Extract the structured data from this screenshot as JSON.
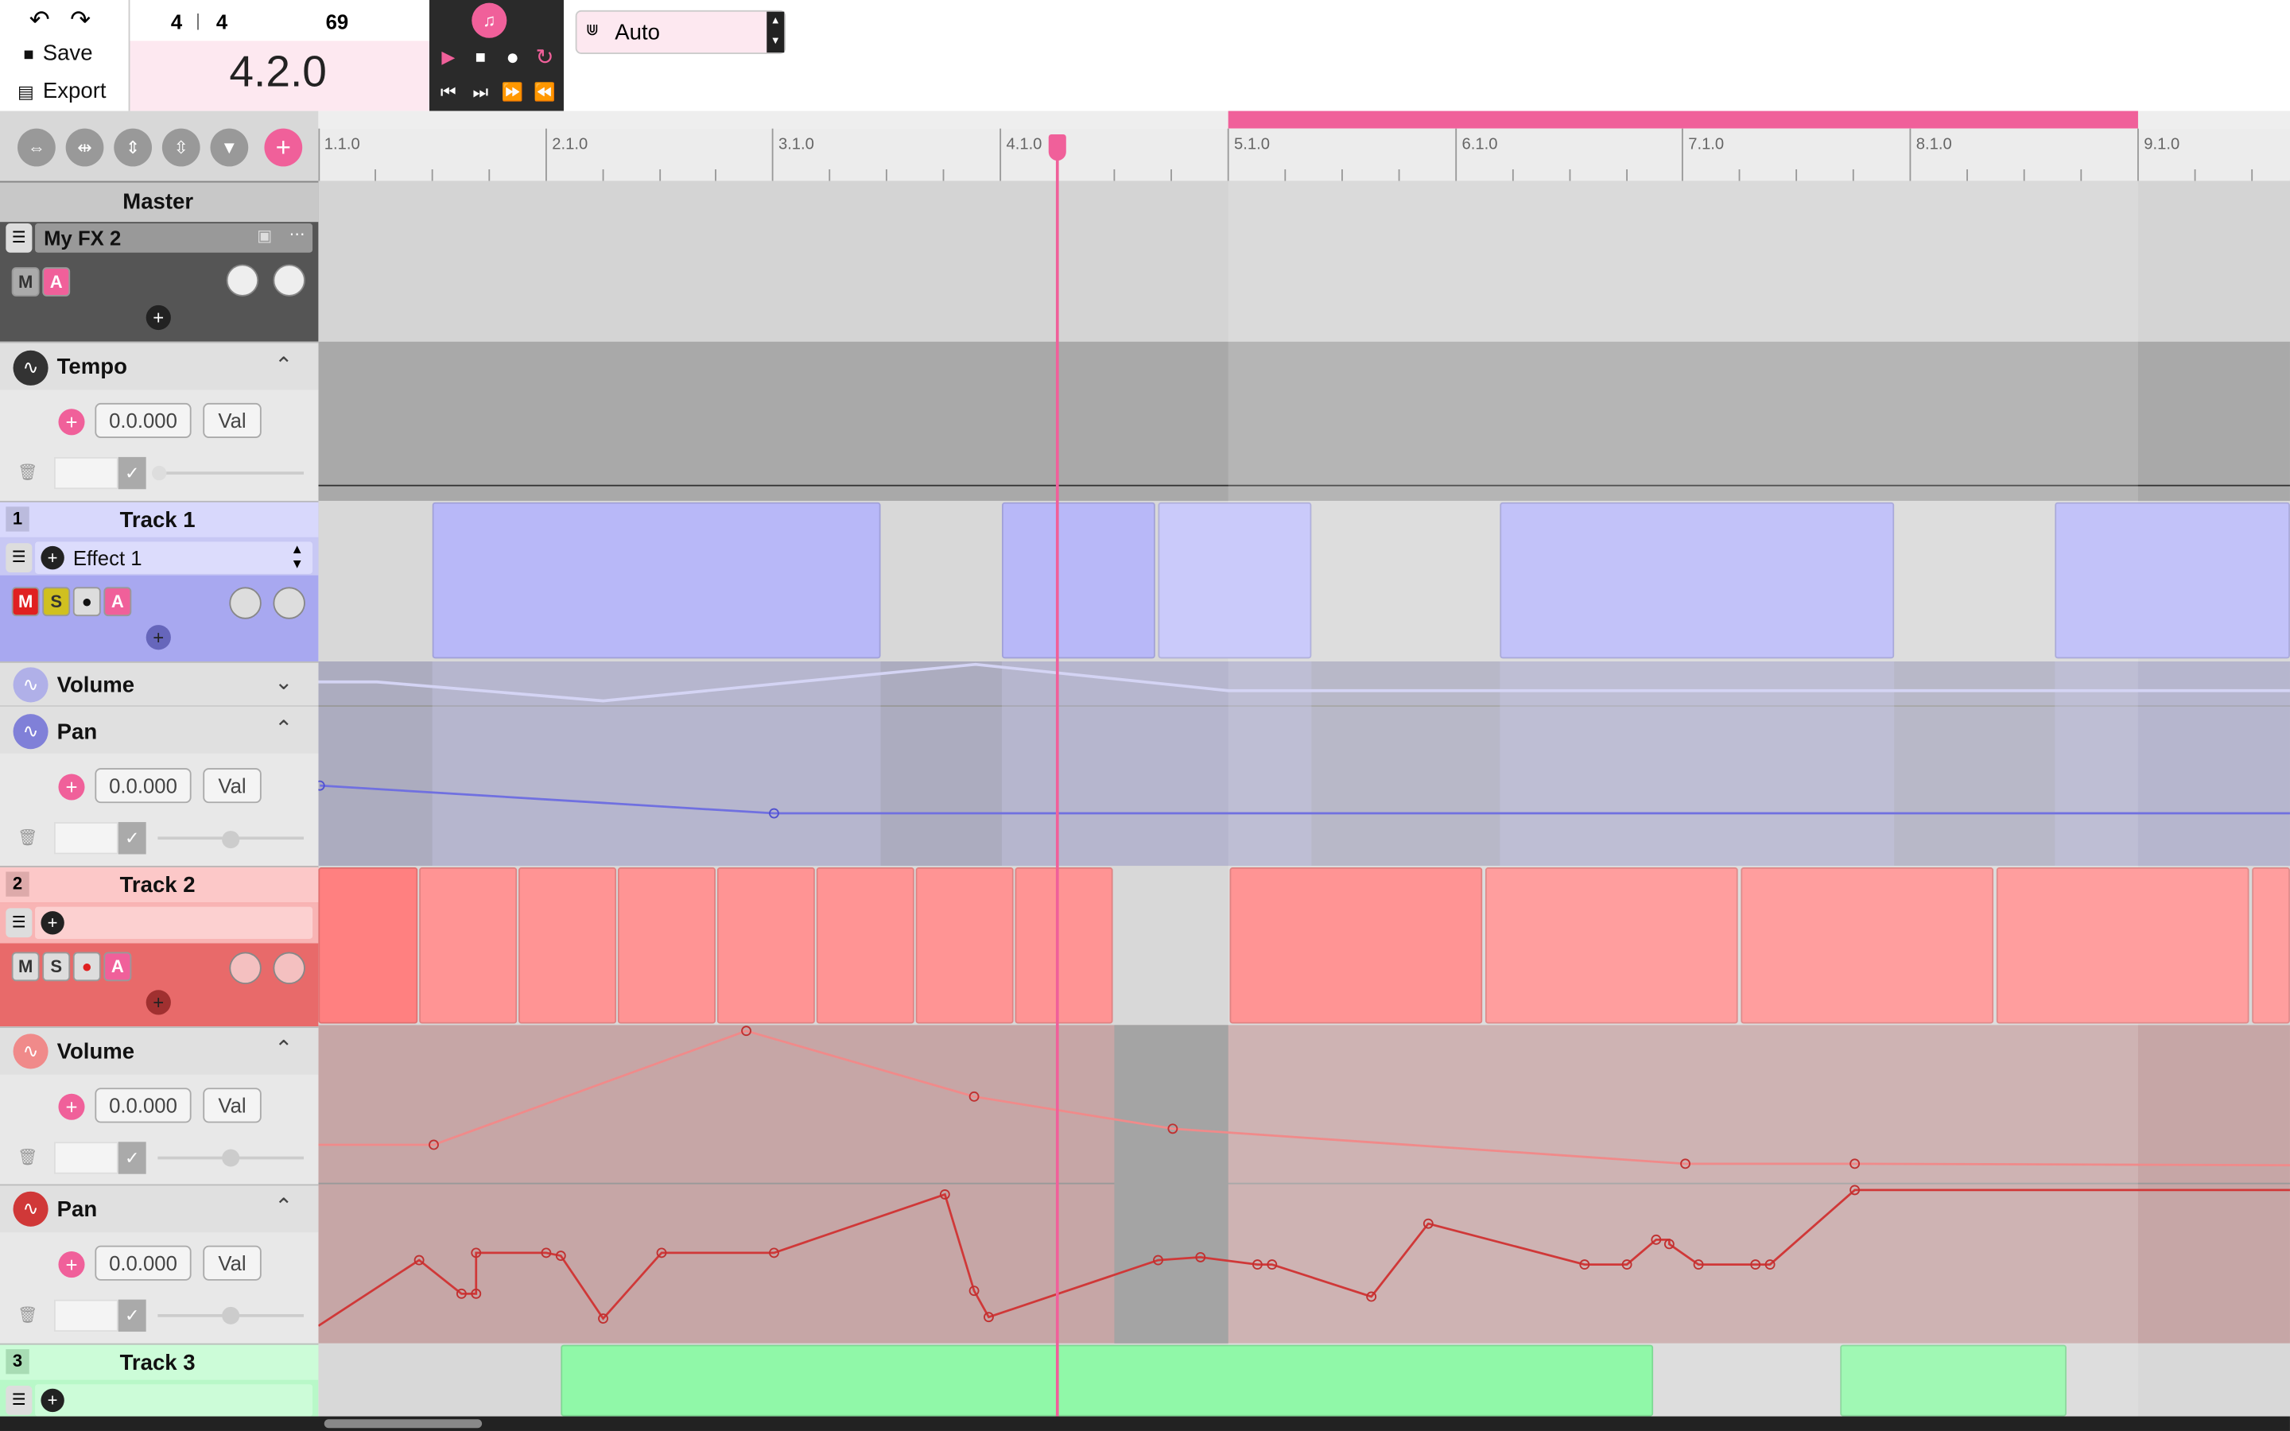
{
  "toolbar": {
    "undo": "undo-icon",
    "redo": "redo-icon",
    "save_label": "Save",
    "export_label": "Export"
  },
  "timesig": {
    "num": "4",
    "sep": "|",
    "den": "4",
    "bpm": "69"
  },
  "position": "4.2.0",
  "snap": {
    "value": "Auto"
  },
  "ruler": {
    "labels": [
      "1.1.0",
      "2.1.0",
      "3.1.0",
      "4.1.0",
      "5.1.0",
      "6.1.0",
      "7.1.0",
      "8.1.0",
      "9.1.0"
    ]
  },
  "master": {
    "title": "Master",
    "fx_name": "My FX 2",
    "mute": "M",
    "auto": "A"
  },
  "tempo": {
    "title": "Tempo",
    "value": "0.0.000",
    "val": "Val"
  },
  "track1": {
    "num": "1",
    "title": "Track 1",
    "effect": "Effect 1",
    "m": "M",
    "s": "S",
    "a": "A",
    "volume": "Volume",
    "pan": "Pan",
    "pan_value": "0.0.000",
    "val": "Val"
  },
  "track2": {
    "num": "2",
    "title": "Track 2",
    "m": "M",
    "s": "S",
    "a": "A",
    "volume": "Volume",
    "volume_value": "0.0.000",
    "pan": "Pan",
    "pan_value": "0.0.000",
    "val": "Val"
  },
  "track3": {
    "num": "3",
    "title": "Track 3"
  },
  "colors": {
    "accent": "#f0609a",
    "track1": "#b8b8f8",
    "track2": "#ff9494",
    "track3": "#90f8a8"
  }
}
